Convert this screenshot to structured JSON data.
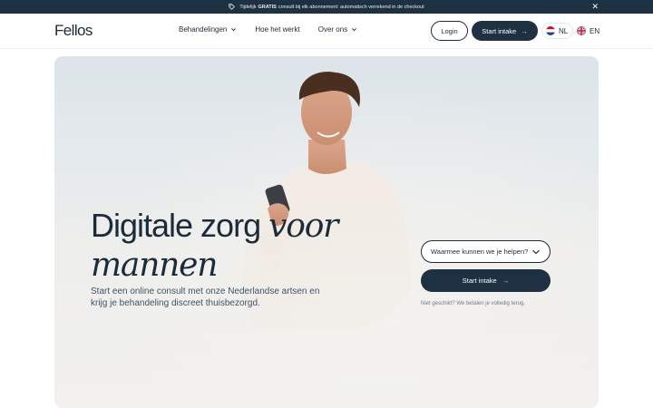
{
  "announcement": {
    "prefix": "Tijdelijk",
    "highlight": "GRATIS",
    "suffix": "consult bij elk abonnement: automatisch verrekend in de checkout",
    "close_glyph": "✕",
    "icon": "tag-icon"
  },
  "header": {
    "logo": "Fellos",
    "menu": [
      {
        "label": "Behandelingen",
        "has_dropdown": true
      },
      {
        "label": "Hoe het werkt",
        "has_dropdown": false
      },
      {
        "label": "Over ons",
        "has_dropdown": true
      }
    ],
    "login_label": "Login",
    "start_label": "Start intake",
    "arrow_glyph": "→",
    "languages": [
      {
        "code": "NL",
        "active": true
      },
      {
        "code": "EN",
        "active": false
      }
    ]
  },
  "hero": {
    "title_plain": "Digitale zorg ",
    "title_italic_1": "voor",
    "title_italic_2": "mannen",
    "subtitle": "Start een online consult met onze Nederlandse artsen en krijg je behandeling discreet thuisbezorgd.",
    "select_placeholder": "Waarmee kunnen we je helpen?",
    "start_label": "Start intake",
    "arrow_glyph": "→",
    "note": "Niet geschikt? We betalen je volledig terug."
  },
  "colors": {
    "navy": "#1e3142",
    "text": "#1c2b3a",
    "hero_top": "#dde4e9",
    "hero_bottom": "#f2f1ee"
  }
}
